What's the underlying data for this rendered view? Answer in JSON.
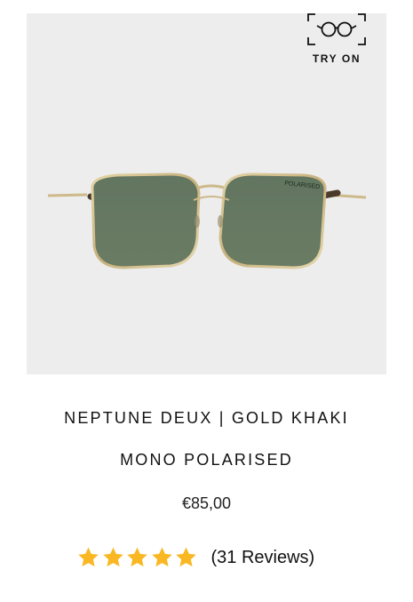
{
  "product": {
    "name_line_1": "NEPTUNE DEUX | GOLD KHAKI",
    "name_line_2": "MONO POLARISED",
    "price": "€85,00",
    "lens_marking": "POLARISED"
  },
  "try_on": {
    "label": "TRY ON",
    "icon": "glasses-frame-icon"
  },
  "rating": {
    "value": 5,
    "max": 5,
    "reviews_text": "(31 Reviews)",
    "icon": "star-icon"
  },
  "colors": {
    "image_background": "#ededed",
    "star": "#f9b823",
    "frame_gold": "#cdb98a",
    "lens_green": "#5f7258",
    "temple_tortoise": "#4a3a2a"
  }
}
